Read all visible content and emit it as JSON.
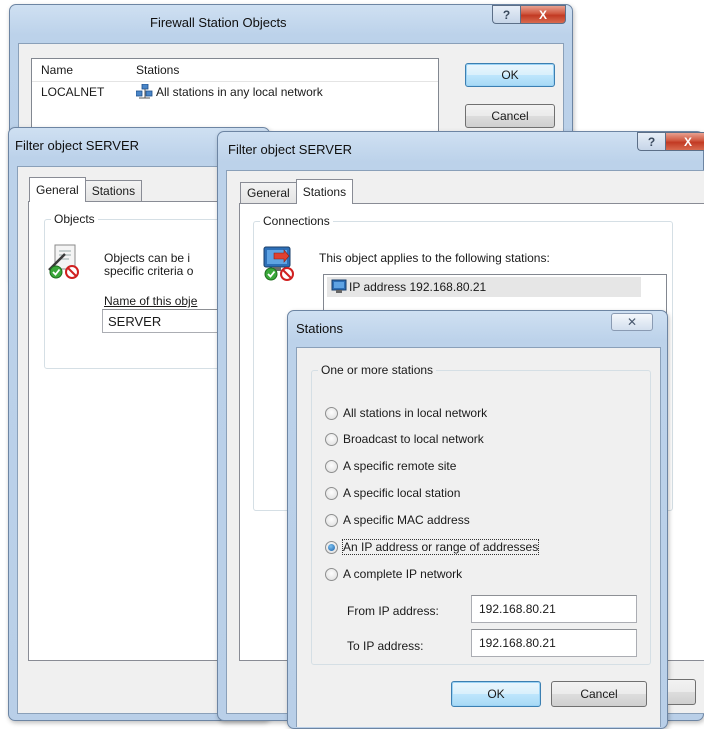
{
  "firewall_window": {
    "title": "Firewall Station Objects",
    "columns": [
      "Name",
      "Stations"
    ],
    "rows": [
      {
        "name": "LOCALNET",
        "stations": "All stations in any local network"
      }
    ],
    "ok_label": "OK",
    "cancel_label": "Cancel",
    "help_glyph": "?",
    "close_glyph": "X"
  },
  "filter_window_back": {
    "title": "Filter object SERVER",
    "tabs": [
      "General",
      "Stations"
    ],
    "group_label": "Objects",
    "description_line1": "Objects can be i",
    "description_line2": "specific criteria o",
    "name_label": "Name of this obje",
    "name_value": "SERVER"
  },
  "filter_window_front": {
    "title": "Filter object SERVER",
    "tabs": [
      "General",
      "Stations"
    ],
    "group_label": "Connections",
    "description": "This object applies to the following stations:",
    "station_item": "IP address 192.168.80.21",
    "help_glyph": "?",
    "close_glyph": "X"
  },
  "stations_dialog": {
    "title": "Stations",
    "close_glyph": "✕",
    "group_label": "One or more stations",
    "options": [
      {
        "label": "All stations in local network",
        "checked": false
      },
      {
        "label": "Broadcast to local network",
        "checked": false
      },
      {
        "label": "A specific remote site",
        "checked": false
      },
      {
        "label": "A specific local station",
        "checked": false
      },
      {
        "label": "A specific MAC address",
        "checked": false
      },
      {
        "label": "An IP address or range of addresses",
        "checked": true
      },
      {
        "label": "A complete IP network",
        "checked": false
      }
    ],
    "from_label": "From IP address:",
    "from_value": "192.168.80.21",
    "to_label": "To IP address:",
    "to_value": "192.168.80.21",
    "ok_label": "OK",
    "cancel_label": "Cancel"
  },
  "icons": {
    "local_network": "network-computers-icon",
    "objects": "document-pen-icon",
    "connections": "monitor-arrow-icon",
    "station": "monitor-icon"
  },
  "colors": {
    "title_bar": "#bcd2ea",
    "close_button": "#c8462e",
    "default_button": "#bee6fd",
    "selection": "#3399ff"
  }
}
